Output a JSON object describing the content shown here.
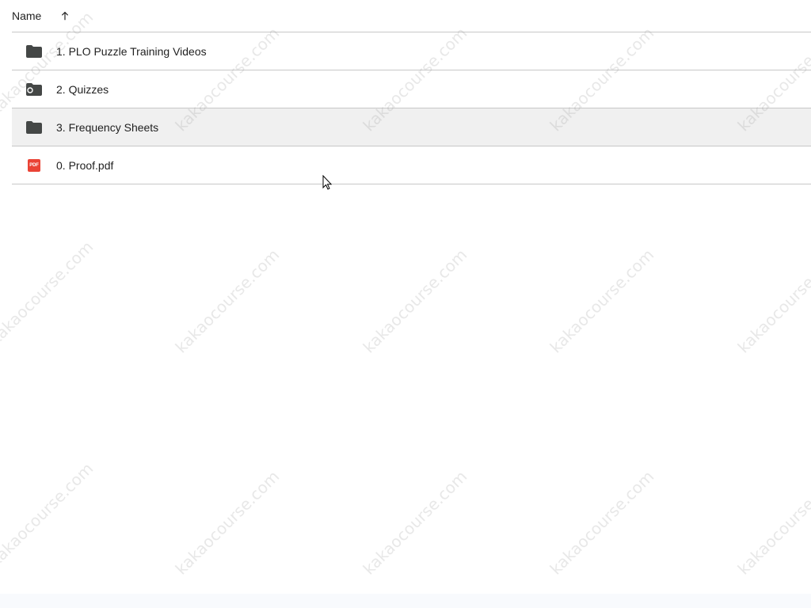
{
  "header": {
    "name_label": "Name",
    "sort_icon": "arrow-up-icon"
  },
  "rows": [
    {
      "name": "1. PLO Puzzle Training Videos",
      "icon": "folder-icon",
      "selected": false
    },
    {
      "name": "2. Quizzes",
      "icon": "shared-folder-icon",
      "selected": false
    },
    {
      "name": "3. Frequency Sheets",
      "icon": "folder-icon",
      "selected": true
    },
    {
      "name": "0. Proof.pdf",
      "icon": "pdf-icon",
      "icon_label": "PDF",
      "selected": false
    }
  ],
  "watermark": {
    "text": "kakaocourse.com"
  },
  "colors": {
    "selected_row": "#f0f0f0",
    "divider": "#c7c7c7",
    "folder_icon": "#444746",
    "pdf_icon": "#ea4335"
  }
}
